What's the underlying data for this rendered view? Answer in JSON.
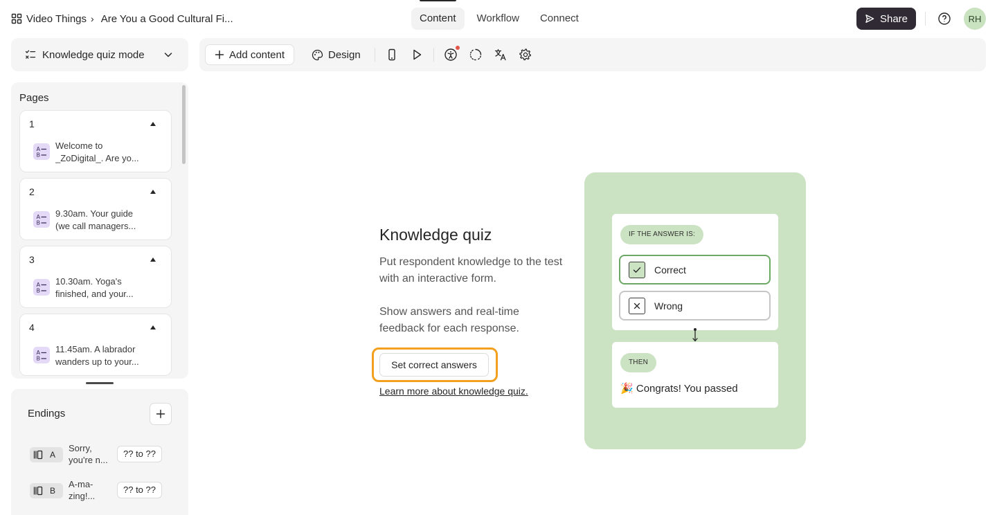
{
  "breadcrumb": {
    "workspace": "Video Things",
    "separator": "›",
    "form": "Are You a Good Cultural Fi..."
  },
  "nav_tabs": [
    {
      "label": "Content",
      "active": true
    },
    {
      "label": "Workflow",
      "active": false
    },
    {
      "label": "Connect",
      "active": false
    }
  ],
  "header": {
    "share_label": "Share",
    "avatar_initials": "RH"
  },
  "mode_selector": {
    "label": "Knowledge quiz mode"
  },
  "toolbar": {
    "add_content_label": "Add content",
    "design_label": "Design",
    "icons": [
      "mobile-preview-icon",
      "play-icon",
      "accessibility-icon",
      "loading-icon",
      "translate-icon",
      "settings-icon"
    ]
  },
  "pages_panel": {
    "title": "Pages",
    "pages": [
      {
        "number": "1",
        "line1": "Welcome to",
        "line2": "_ZoDigital_. Are yo..."
      },
      {
        "number": "2",
        "line1": "9.30am. Your guide",
        "line2": "(we call managers..."
      },
      {
        "number": "3",
        "line1": "10.30am. Yoga's",
        "line2": "finished, and your..."
      },
      {
        "number": "4",
        "line1": "11.45am. A labrador",
        "line2": "wanders up to your..."
      }
    ]
  },
  "endings_panel": {
    "title": "Endings",
    "endings": [
      {
        "letter": "A",
        "line1": "Sorry,",
        "line2": "you're n...",
        "range": "?? to ??"
      },
      {
        "letter": "B",
        "line1": "A-ma-",
        "line2": "zing!...",
        "range": "?? to ??"
      }
    ]
  },
  "main": {
    "title": "Knowledge quiz",
    "paragraph1": "Put respondent knowledge to the test with an interactive form.",
    "paragraph2": "Show answers and real-time feedback for each response.",
    "set_answers_label": "Set correct answers",
    "learn_more_label": "Learn more about knowledge quiz."
  },
  "illustration": {
    "if_label": "IF THE ANSWER IS:",
    "correct_label": "Correct",
    "wrong_label": "Wrong",
    "then_label": "THEN",
    "congrats_emoji": "🎉",
    "congrats_text": "Congrats! You passed"
  },
  "colors": {
    "accent_highlight": "#f2a01d",
    "share_button": "#2f2a33",
    "illustration_bg": "#cbe3c2",
    "correct_border": "#6aa863",
    "quiz_icon_bg": "#e4daf7"
  }
}
